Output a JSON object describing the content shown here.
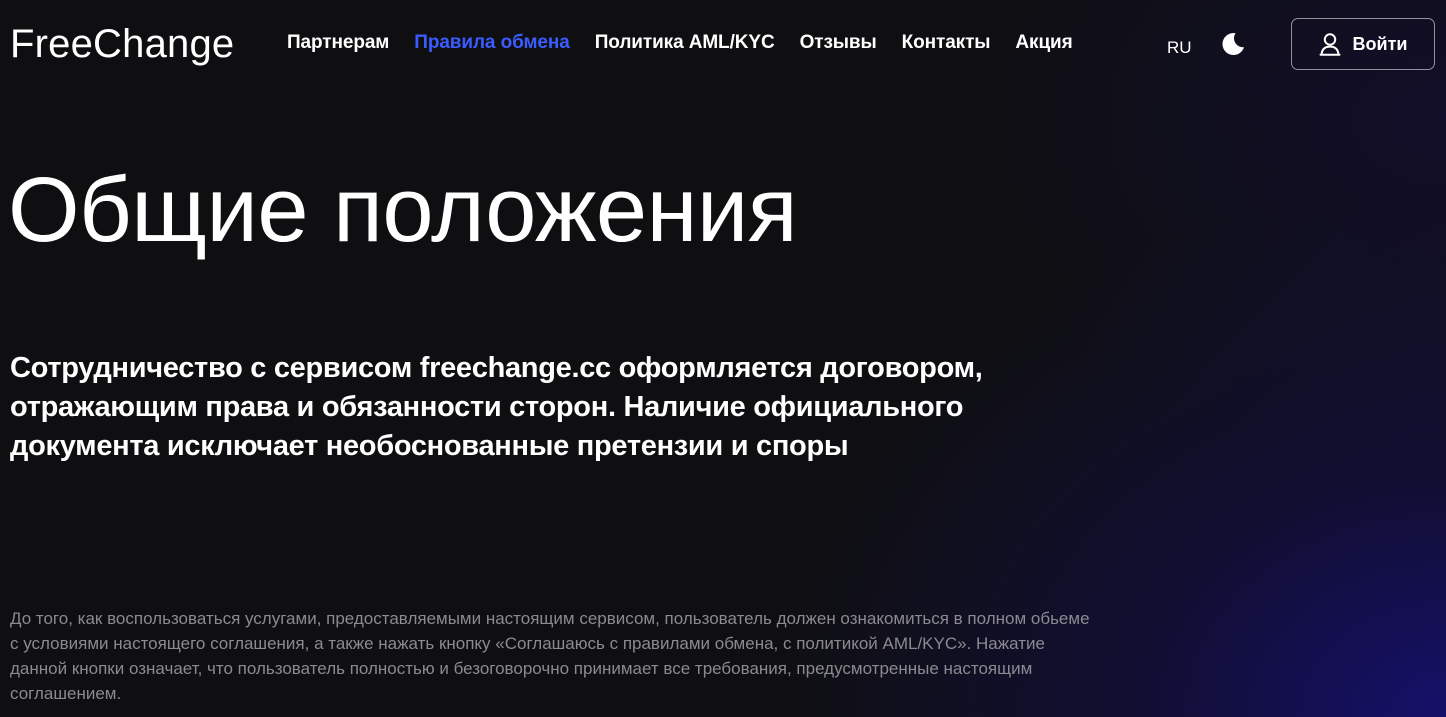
{
  "header": {
    "logo": "FreeChange",
    "nav": [
      {
        "label": "Партнерам",
        "active": false
      },
      {
        "label": "Правила обмена",
        "active": true
      },
      {
        "label": "Политика AML/KYC",
        "active": false
      },
      {
        "label": "Отзывы",
        "active": false
      },
      {
        "label": "Контакты",
        "active": false
      },
      {
        "label": "Акция",
        "active": false
      }
    ],
    "language": "RU",
    "theme_icon": "moon-icon",
    "login_icon": "user-icon",
    "login_label": "Войти"
  },
  "main": {
    "title": "Общие положения",
    "lead": "Сотрудничество с сервисом freechange.cc оформляется договором, отражающим права и обязанности сторон. Наличие официального документа исключает необоснованные претензии и споры",
    "body": "До того, как воспользоваться услугами, предоставляемыми настоящим сервисом, пользователь должен ознакомиться в полном обьеме с условиями настоящего соглашения, а также нажать кнопку «Соглашаюсь с правилами обмена, с политикой AML/KYC». Нажатие данной кнопки означает, что пользователь полностью и безоговорочно принимает все требования, предусмотренные настоящим соглашением."
  },
  "colors": {
    "accent": "#3a5cff",
    "background": "#0f0f12",
    "muted_text": "#8a8a90",
    "gradient_glow": "#16106e"
  }
}
